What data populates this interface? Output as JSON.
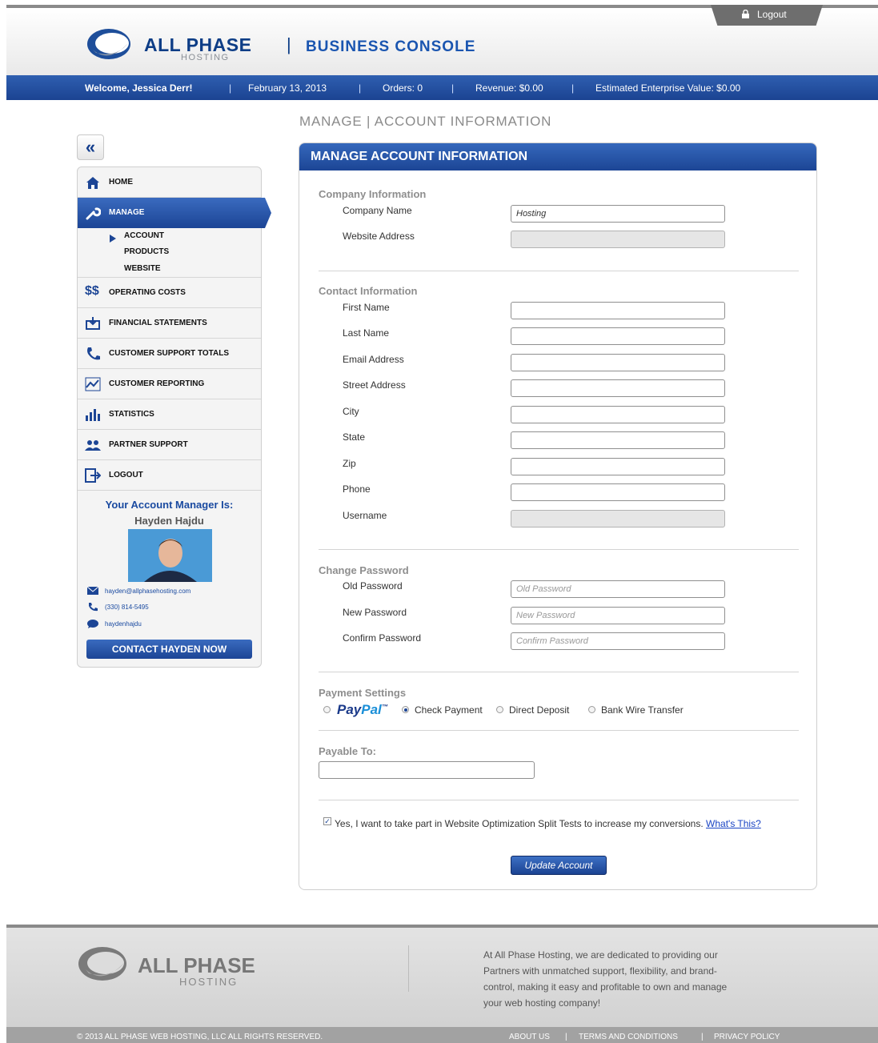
{
  "header": {
    "logo_word": "ALL PHASE",
    "logo_sub": "HOSTING",
    "separator": "|",
    "console_title": "BUSINESS CONSOLE",
    "logout_label": "Logout"
  },
  "status_bar": {
    "welcome": "Welcome, Jessica Derr!",
    "date": "February 13, 2013",
    "orders": "Orders: 0",
    "revenue": "Revenue: $0.00",
    "enterprise_value": "Estimated Enterprise Value: $0.00",
    "divider": "|"
  },
  "breadcrumb": "MANAGE | ACCOUNT INFORMATION",
  "sidebar": {
    "collapse_glyph": "«",
    "items": [
      {
        "label": "HOME",
        "icon": "home-icon"
      },
      {
        "label": "MANAGE",
        "icon": "wrench-icon"
      },
      {
        "label": "OPERATING COSTS",
        "icon": "dollar-icon",
        "glyph": "$$"
      },
      {
        "label": "FINANCIAL STATEMENTS",
        "icon": "statement-icon"
      },
      {
        "label": "CUSTOMER SUPPORT TOTALS",
        "icon": "phone-icon"
      },
      {
        "label": "CUSTOMER REPORTING",
        "icon": "chart-line-icon"
      },
      {
        "label": "STATISTICS",
        "icon": "bar-chart-icon"
      },
      {
        "label": "PARTNER SUPPORT",
        "icon": "people-icon"
      },
      {
        "label": "LOGOUT",
        "icon": "logout-icon"
      }
    ],
    "sub_items": [
      "ACCOUNT",
      "PRODUCTS",
      "WEBSITE"
    ],
    "manager": {
      "title": "Your Account Manager Is:",
      "name": "Hayden Hajdu",
      "email": "hayden@allphasehosting.com",
      "phone": "(330) 814-5495",
      "chat": "haydenhajdu",
      "contact_button": "CONTACT HAYDEN NOW"
    }
  },
  "panel": {
    "title": "MANAGE ACCOUNT INFORMATION",
    "company": {
      "section_title": "Company Information",
      "company_name_label": "Company Name",
      "company_name_value": "Hosting",
      "website_label": "Website Address"
    },
    "contact": {
      "section_title": "Contact Information",
      "fields": [
        "First Name",
        "Last Name",
        "Email Address",
        "Street Address",
        "City",
        "State",
        "Zip",
        "Phone",
        "Username"
      ]
    },
    "password": {
      "section_title": "Change Password",
      "old_label": "Old Password",
      "old_placeholder": "Old Password",
      "new_label": "New Password",
      "new_placeholder": "New Password",
      "confirm_label": "Confirm Password",
      "confirm_placeholder": "Confirm Password"
    },
    "payment": {
      "section_title": "Payment Settings",
      "paypal_pay": "Pay",
      "paypal_pal": "Pal",
      "paypal_tm": "™",
      "check_label": "Check Payment",
      "deposit_label": "Direct Deposit",
      "wire_label": "Bank Wire Transfer",
      "selected": "Check Payment"
    },
    "payable": {
      "section_title": "Payable To:"
    },
    "split_test": {
      "text": "Yes, I want to take part in Website Optimization Split Tests to increase my conversions.",
      "link": "What's This?",
      "checked": true
    },
    "update_button": "Update Account"
  },
  "footer": {
    "logo_word": "ALL PHASE",
    "logo_sub": "HOSTING",
    "blurb": "At All Phase Hosting, we are dedicated to providing our Partners with unmatched support, flexibility, and brand-control, making it easy and profitable to own and manage your web hosting company!",
    "copyright": "© 2013 ALL PHASE WEB HOSTING, LLC ALL RIGHTS RESERVED.",
    "links": [
      "ABOUT US",
      "TERMS AND CONDITIONS",
      "PRIVACY POLICY"
    ],
    "link_divider": "|"
  },
  "colors": {
    "brand_blue": "#1c4595",
    "header_blue": "#0d3d86",
    "link_blue": "#1a44c4"
  }
}
